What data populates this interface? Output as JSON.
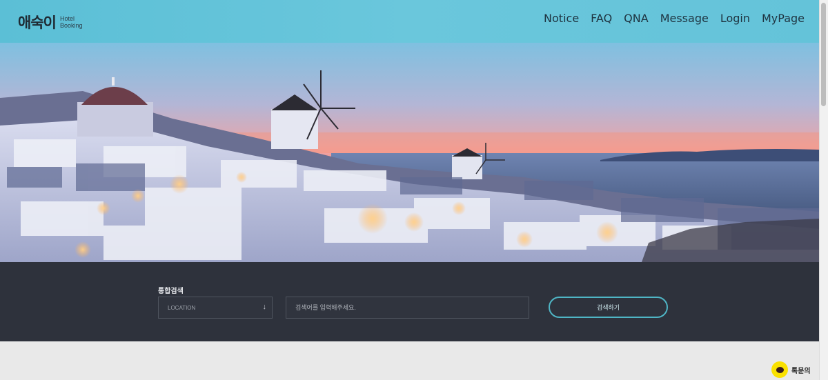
{
  "header": {
    "logo_text": "애숙이",
    "logo_sub_line1": "Hotel",
    "logo_sub_line2": "Booking",
    "nav": [
      "Notice",
      "FAQ",
      "QNA",
      "Message",
      "Login",
      "MyPage"
    ]
  },
  "hero": {
    "image": "santorini-sunset-village"
  },
  "search": {
    "title": "통합검색",
    "location_value": "LOCATION",
    "location_icon": "arrow-down-icon",
    "keyword_placeholder": "검색어를 입력해주세요.",
    "button_label": "검색하기"
  },
  "chat": {
    "label": "톡문의",
    "icon": "kakao-chat-icon"
  },
  "colors": {
    "header_bg": "#64c3d9",
    "search_band_bg": "#2e323c",
    "accent": "#4fb5c5"
  }
}
